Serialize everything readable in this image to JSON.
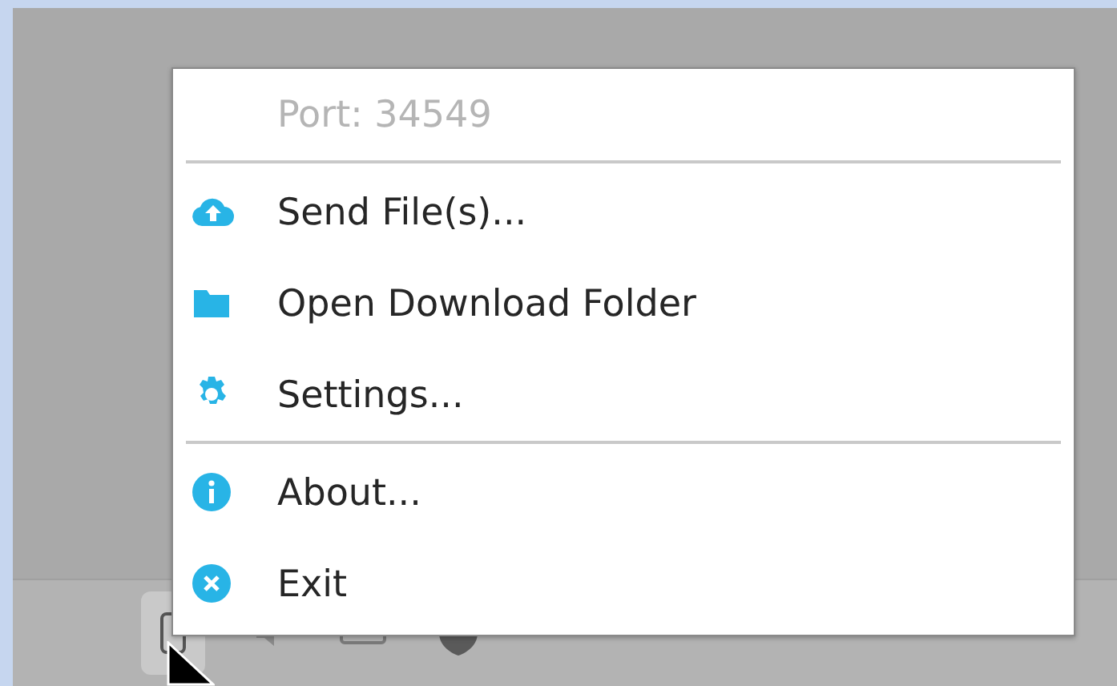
{
  "menu": {
    "items": [
      {
        "kind": "label",
        "label": "Port: 34549",
        "disabled": true
      },
      {
        "kind": "separator"
      },
      {
        "kind": "action",
        "label": "Send File(s)...",
        "disabled": false
      },
      {
        "kind": "action",
        "label": "Open Download Folder",
        "disabled": false
      },
      {
        "kind": "action",
        "label": "Settings...",
        "disabled": false
      },
      {
        "kind": "separator"
      },
      {
        "kind": "action",
        "label": "About...",
        "disabled": false
      },
      {
        "kind": "action",
        "label": "Exit",
        "disabled": false
      }
    ]
  }
}
